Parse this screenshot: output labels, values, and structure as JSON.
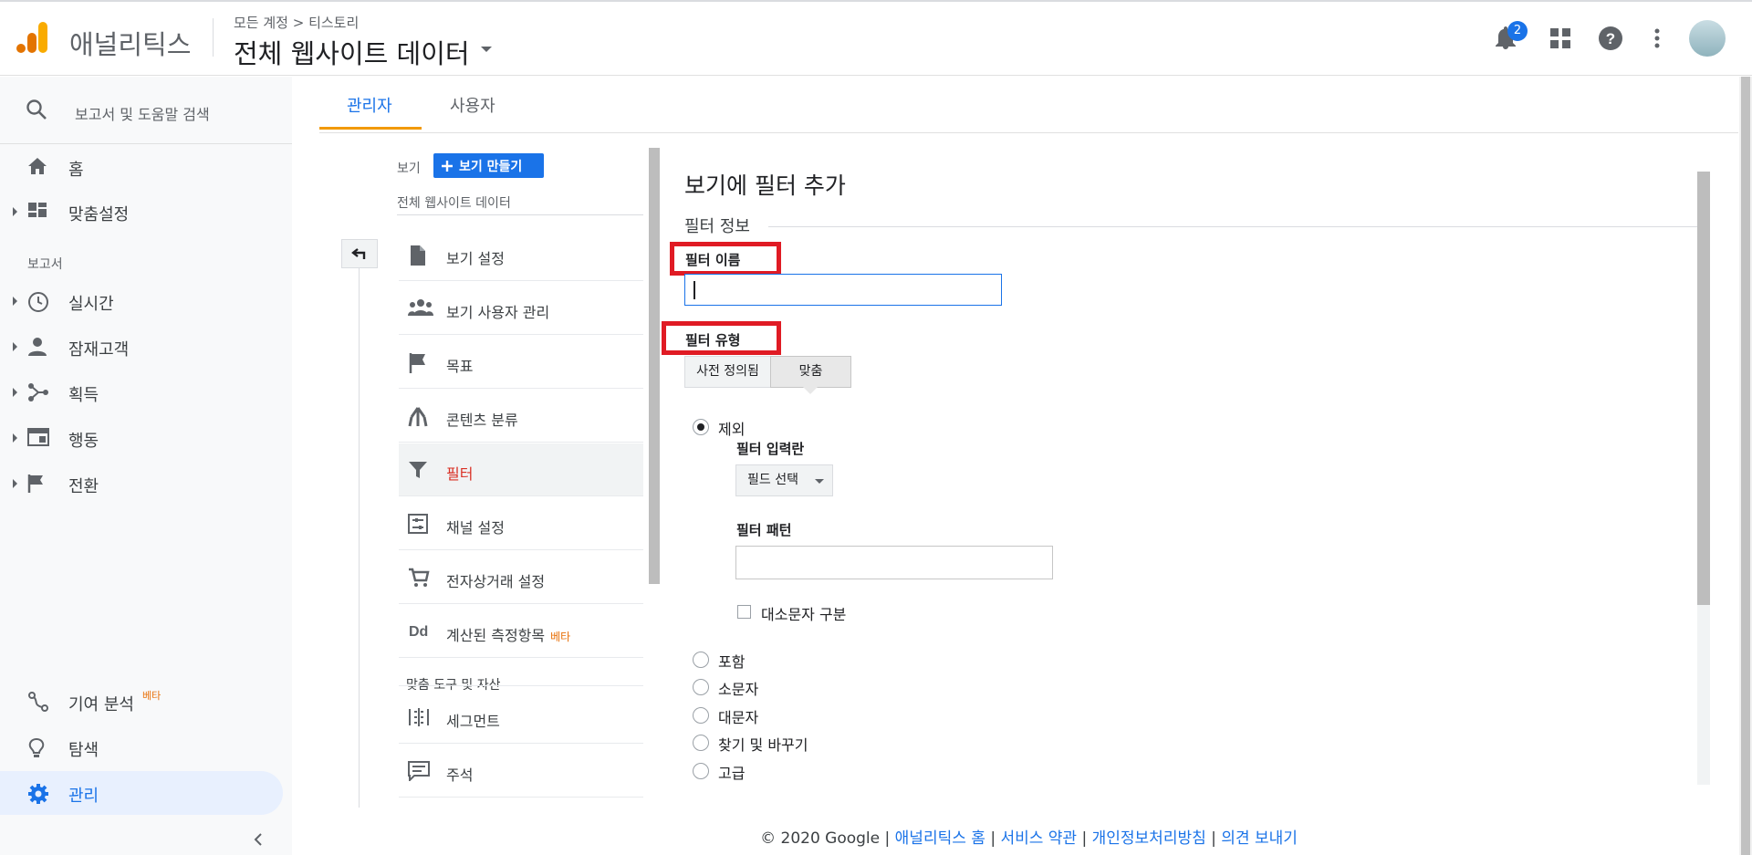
{
  "header": {
    "app_name": "애널리틱스",
    "breadcrumb": "모든 계정 > 티스토리",
    "view_title": "전체 웹사이트 데이터",
    "notification_count": "2"
  },
  "nav": {
    "search_placeholder": "보고서 및 도움말 검색",
    "home": "홈",
    "customization": "맞춤설정",
    "reports_section": "보고서",
    "realtime": "실시간",
    "audience": "잠재고객",
    "acquisition": "획득",
    "behavior": "행동",
    "conversions": "전환",
    "attribution": "기여 분석",
    "attribution_badge": "베타",
    "discover": "탐색",
    "admin": "관리"
  },
  "tabs": {
    "admin": "관리자",
    "user": "사용자"
  },
  "view_column": {
    "label": "보기",
    "create_button": "보기 만들기",
    "view_name": "전체 웹사이트 데이터",
    "items": [
      {
        "label": "보기 설정",
        "icon": "document-icon"
      },
      {
        "label": "보기 사용자 관리",
        "icon": "people-icon"
      },
      {
        "label": "목표",
        "icon": "flag-icon"
      },
      {
        "label": "콘텐츠 분류",
        "icon": "content-grouping-icon"
      },
      {
        "label": "필터",
        "icon": "filter-icon"
      },
      {
        "label": "채널 설정",
        "icon": "channel-settings-icon"
      },
      {
        "label": "전자상거래 설정",
        "icon": "cart-icon"
      },
      {
        "label": "계산된 측정항목",
        "icon": "dd-icon",
        "badge": "베타"
      }
    ],
    "tools_heading": "맞춤 도구 및 자산",
    "tools": [
      {
        "label": "세그먼트",
        "icon": "segment-icon"
      },
      {
        "label": "주석",
        "icon": "annotation-icon"
      }
    ]
  },
  "filter_panel": {
    "title": "보기에 필터 추가",
    "section": "필터 정보",
    "name_label": "필터 이름",
    "name_value": "",
    "type_label": "필터 유형",
    "seg_predefined": "사전 정의됨",
    "seg_custom": "맞춤",
    "radio_exclude": "제외",
    "field_label": "필터 입력란",
    "field_select": "필드 선택",
    "pattern_label": "필터 패턴",
    "pattern_value": "",
    "case_sensitive": "대소문자 구분",
    "radio_include": "포함",
    "radio_lowercase": "소문자",
    "radio_uppercase": "대문자",
    "radio_search_replace": "찾기 및 바꾸기",
    "radio_advanced": "고급"
  },
  "footer": {
    "copyright": "© 2020 Google",
    "links": [
      "애널리틱스 홈",
      "서비스 약관",
      "개인정보처리방침",
      "의견 보내기"
    ],
    "separator": "|"
  },
  "colors": {
    "accent": "#1a73e8",
    "highlight_box": "#e01b24",
    "tab_underline": "#f29900",
    "active_filter": "#d93025"
  }
}
